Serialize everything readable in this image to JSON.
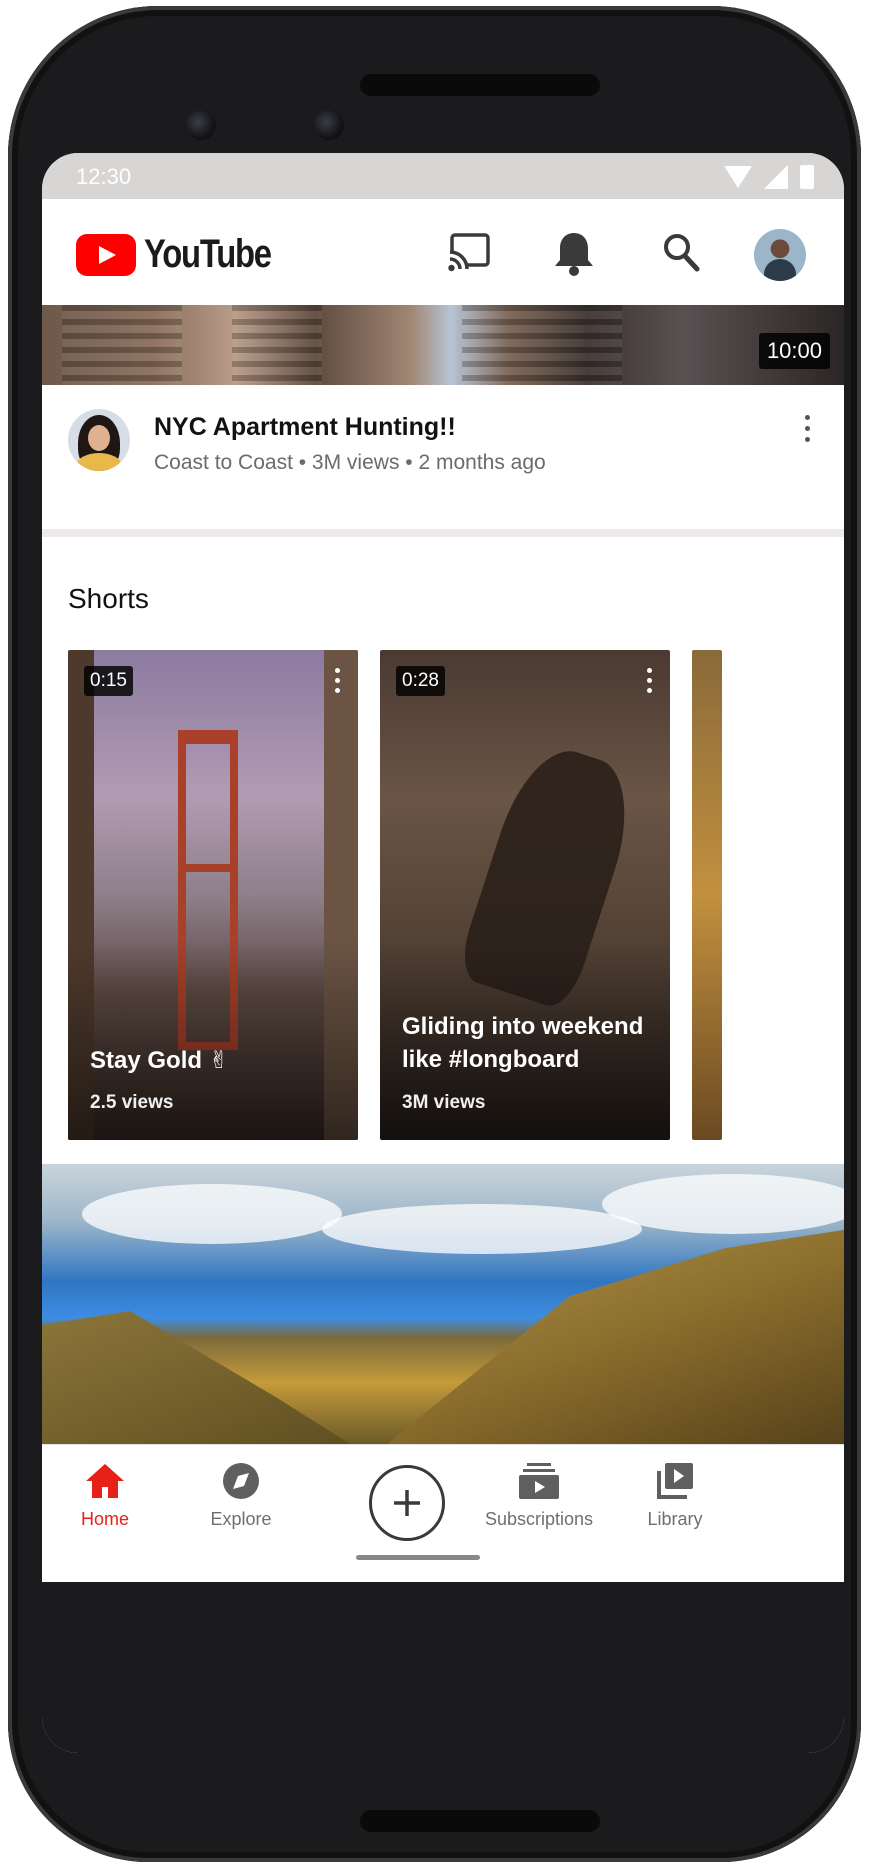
{
  "status_bar": {
    "time": "12:30"
  },
  "header": {
    "brand": "YouTube",
    "icons": [
      "cast-icon",
      "bell-icon",
      "search-icon",
      "avatar"
    ]
  },
  "top_video": {
    "duration": "10:00",
    "title": "NYC Apartment Hunting!!",
    "meta": "Coast to Coast • 3M views • 2 months ago"
  },
  "shorts": {
    "heading": "Shorts",
    "items": [
      {
        "duration": "0:15",
        "title": "Stay Gold ✌",
        "views": "2.5 views"
      },
      {
        "duration": "0:28",
        "title": "Gliding into weekend like #longboard",
        "views": "3M views"
      }
    ]
  },
  "bottom_nav": {
    "items": [
      {
        "label": "Home",
        "icon": "home-icon",
        "active": true
      },
      {
        "label": "Explore",
        "icon": "compass-icon",
        "active": false
      },
      {
        "label": "",
        "icon": "create-icon",
        "active": false
      },
      {
        "label": "Subscriptions",
        "icon": "subscriptions-icon",
        "active": false
      },
      {
        "label": "Library",
        "icon": "library-icon",
        "active": false
      }
    ]
  },
  "colors": {
    "brand_red": "#ff0000",
    "active_nav": "#e62117"
  }
}
